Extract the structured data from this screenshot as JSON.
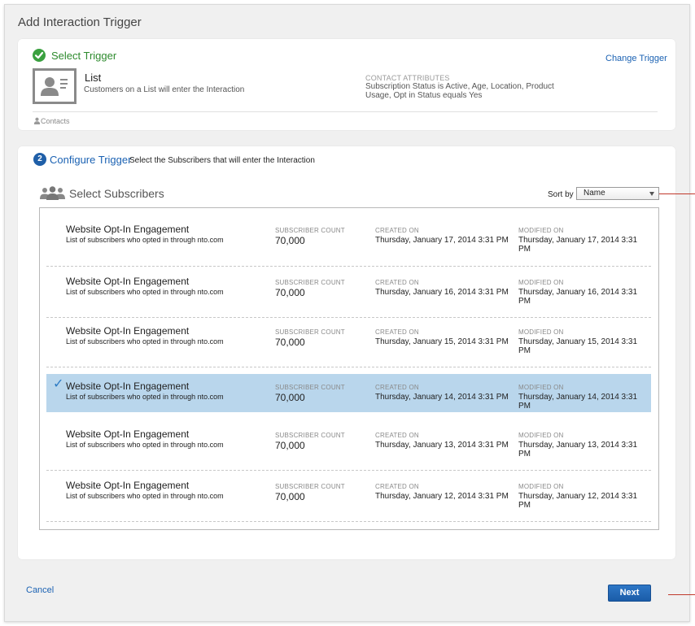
{
  "dialog": {
    "title": "Add Interaction Trigger"
  },
  "section1": {
    "title": "Select Trigger",
    "change_link": "Change Trigger",
    "trigger_name": "List",
    "trigger_desc": "Customers on a List will enter the Interaction",
    "attributes_label": "CONTACT ATTRIBUTES",
    "attributes_value": "Subscription Status is Active, Age, Location, Product Usage, Opt in Status equals Yes",
    "contacts_label": "Contacts"
  },
  "section2": {
    "step_number": "2",
    "title": "Configure Trigger",
    "description": "Select the Subscribers that will enter the Interaction",
    "subsection_title": "Select Subscribers",
    "sort_label": "Sort by",
    "sort_value": "Name"
  },
  "columns": {
    "count": "SUBSCRIBER COUNT",
    "created": "CREATED ON",
    "modified": "MODIFIED ON"
  },
  "rows": [
    {
      "name": "Website Opt-In Engagement",
      "desc": "List of subscribers who opted in through nto.com",
      "count": "70,000",
      "created": "Thursday, January 17, 2014 3:31 PM",
      "modified": "Thursday, January 17, 2014 3:31 PM"
    },
    {
      "name": "Website Opt-In Engagement",
      "desc": "List of subscribers who opted in through nto.com",
      "count": "70,000",
      "created": "Thursday, January 16, 2014 3:31 PM",
      "modified": "Thursday, January 16, 2014 3:31 PM"
    },
    {
      "name": "Website Opt-In Engagement",
      "desc": "List of subscribers who opted in through nto.com",
      "count": "70,000",
      "created": "Thursday, January 15, 2014 3:31 PM",
      "modified": "Thursday, January 15, 2014 3:31 PM"
    },
    {
      "name": "Website Opt-In Engagement",
      "desc": "List of subscribers who opted in through nto.com",
      "count": "70,000",
      "created": "Thursday, January 14, 2014 3:31 PM",
      "modified": "Thursday, January 14, 2014 3:31 PM",
      "selected": true
    },
    {
      "name": "Website Opt-In Engagement",
      "desc": "List of subscribers who opted in through nto.com",
      "count": "70,000",
      "created": "Thursday, January 13, 2014 3:31 PM",
      "modified": "Thursday, January 13, 2014 3:31 PM"
    },
    {
      "name": "Website Opt-In Engagement",
      "desc": "List of subscribers who opted in through nto.com",
      "count": "70,000",
      "created": "Thursday, January 12, 2014 3:31 PM",
      "modified": "Thursday, January 12, 2014 3:31 PM"
    }
  ],
  "footer": {
    "cancel_label": "Cancel",
    "next_label": "Next"
  },
  "colors": {
    "accent": "#1b62b3",
    "success": "#3aa03f",
    "selected_row": "#b9d6ec"
  }
}
